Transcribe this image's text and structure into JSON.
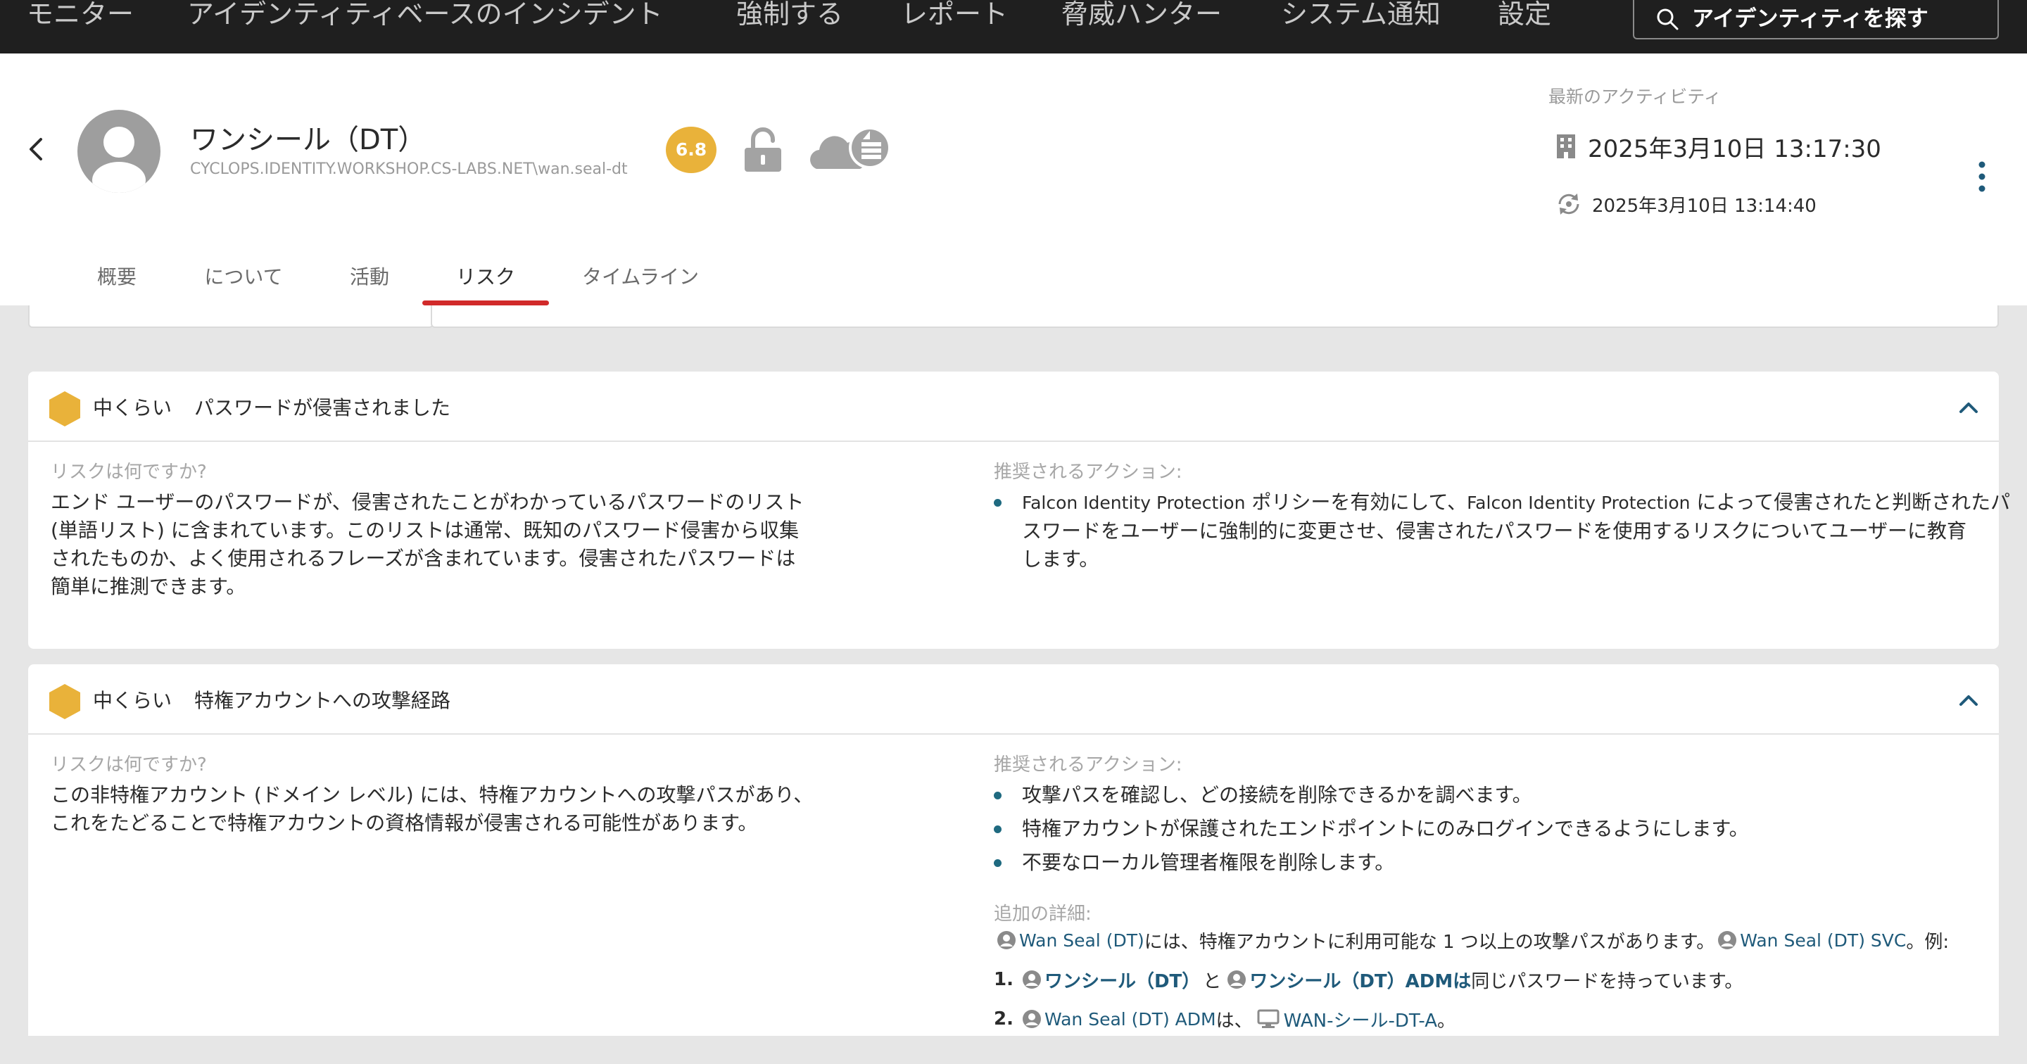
{
  "nav": {
    "items": [
      "モニター",
      "アイデンティティベースのインシデント",
      "強制する",
      "レポート",
      "脅威ハンター",
      "システム通知",
      "設定"
    ],
    "search_placeholder": "アイデンティティを探す"
  },
  "identity": {
    "name": "ワンシール（DT）",
    "path": "CYCLOPS.IDENTITY.WORKSHOP.CS-LABS.NET\\wan.seal-dt",
    "risk_score": "6.8",
    "activity_label": "最新のアクティビティ",
    "activity_primary": "2025年3月10日 13:17:30",
    "activity_secondary": "2025年3月10日 13:14:40"
  },
  "tabs": [
    "概要",
    "について",
    "活動",
    "リスク",
    "タイムライン"
  ],
  "active_tab": "リスク",
  "colors": {
    "severity_medium": "#e9b23a",
    "active_tab_underline": "#d12a2a",
    "link": "#1f5a7a",
    "nav_background": "#1f1f1f"
  },
  "risks": [
    {
      "severity": "中くらい",
      "title": "パスワードが侵害されました",
      "what_label": "リスクは何ですか?",
      "what_lines": [
        "エンド ユーザーのパスワードが、侵害されたことがわかっているパスワードのリスト",
        "(単語リスト) に含まれています。このリストは通常、既知のパスワード侵害から収集",
        "されたものか、よく使用されるフレーズが含まれています。侵害されたパスワードは",
        "簡単に推測できます。"
      ],
      "actions_label": "推奨されるアクション:",
      "actions": [
        {
          "line1_en1": "Falcon Identity Protection",
          "line1_ja1": " ポリシーを有効にして、",
          "line1_en2": "Falcon Identity Protection",
          "line1_ja2": " によって侵害されたと判断されたパ",
          "line2": "スワードをユーザーに強制的に変更させ、侵害されたパスワードを使用するリスクについてユーザーに教育",
          "line3": "します。"
        }
      ]
    },
    {
      "severity": "中くらい",
      "title": "特権アカウントへの攻撃経路",
      "what_label": "リスクは何ですか?",
      "what_lines": [
        "この非特権アカウント (ドメイン レベル) には、特権アカウントへの攻撃パスがあり、",
        "これをたどることで特権アカウントの資格情報が侵害される可能性があります。"
      ],
      "actions_label": "推奨されるアクション:",
      "actions": [
        "攻撃パスを確認し、どの接続を削除できるかを調べます。",
        "特権アカウントが保護されたエンドポイントにのみログインできるようにします。",
        "不要なローカル管理者権限を削除します。"
      ],
      "details_label": "追加の詳細:",
      "details": {
        "line1_user": "Wan Seal (DT)",
        "line1_text": "には、特権アカウントに利用可能な 1 つ以上の攻撃パスがあります。",
        "line1_user2": "Wan Seal (DT) SVC",
        "line1_tail": "。例:",
        "item1_num": "1.",
        "item1_user_a": "ワンシール（DT）",
        "item1_and": "と",
        "item1_user_b": "ワンシール（DT）ADMは",
        "item1_text": "同じパスワードを持っています。",
        "item2_num": "2.",
        "item2_user": "Wan Seal (DT) ADM",
        "item2_text": "は、",
        "item2_host": "WAN-シール-DT-A",
        "item2_tail": "。"
      }
    }
  ]
}
